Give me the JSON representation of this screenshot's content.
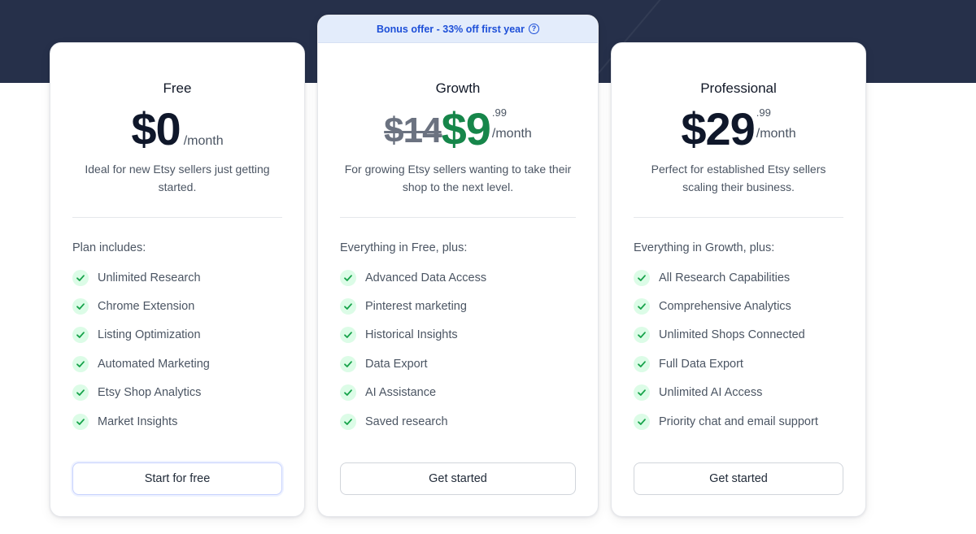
{
  "bonus": {
    "text": "Bonus offer - 33% off first year",
    "help_icon": "?"
  },
  "plans": [
    {
      "name": "Free",
      "price": "$0",
      "period": "/month",
      "description": "Ideal for new Etsy sellers just getting started.",
      "includes_title": "Plan includes:",
      "features": [
        "Unlimited Research",
        "Chrome Extension",
        "Listing Optimization",
        "Automated Marketing",
        "Etsy Shop Analytics",
        "Market Insights"
      ],
      "cta": "Start for free"
    },
    {
      "name": "Growth",
      "old_price": "$14",
      "price": "$9",
      "cents": ".99",
      "period": "/month",
      "description": "For growing Etsy sellers wanting to take their shop to the next level.",
      "includes_title": "Everything in Free, plus:",
      "features": [
        "Advanced Data Access",
        "Pinterest marketing",
        "Historical Insights",
        "Data Export",
        "AI Assistance",
        "Saved research"
      ],
      "cta": "Get started"
    },
    {
      "name": "Professional",
      "price": "$29",
      "cents": ".99",
      "period": "/month",
      "description": "Perfect for established Etsy sellers scaling their business.",
      "includes_title": "Everything in Growth, plus:",
      "features": [
        "All Research Capabilities",
        "Comprehensive Analytics",
        "Unlimited Shops Connected",
        "Full Data Export",
        "Unlimited AI Access",
        "Priority chat and email support"
      ],
      "cta": "Get started"
    }
  ],
  "colors": {
    "hero": "#26304a",
    "accent_blue": "#1d4fd8",
    "discount_green": "#16864a",
    "check_bg": "#dcfce7",
    "check_mark": "#16a34a"
  },
  "icons": {
    "feature": "check-icon",
    "help": "question-circle-icon"
  }
}
